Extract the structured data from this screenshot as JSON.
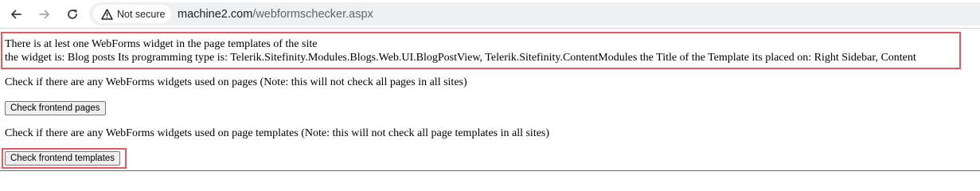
{
  "browser": {
    "security_label": "Not secure",
    "url_host": "machine2.com",
    "url_path": "/webformschecker.aspx",
    "icons": {
      "back": "back-arrow-icon",
      "forward": "forward-arrow-icon",
      "reload": "reload-icon",
      "security": "warning-triangle-icon"
    }
  },
  "result": {
    "line1": "There is at lest one WebForms widget in the page templates of the site",
    "line2": "the widget is: Blog posts Its programming type is: Telerik.Sitefinity.Modules.Blogs.Web.UI.BlogPostView, Telerik.Sitefinity.ContentModules the Title of the Template its placed on: Right Sidebar, Content"
  },
  "pages_check": {
    "description": "Check if there are any WebForms widgets used on pages (Note: this will not check all pages in all sites)",
    "button_label": "Check frontend pages"
  },
  "templates_check": {
    "description": "Check if there are any WebForms widgets used on page templates (Note: this will not check all page templates in all sites)",
    "button_label": "Check frontend templates"
  },
  "colors": {
    "highlight": "#e35b61",
    "omnibox": "#eef1f4"
  }
}
